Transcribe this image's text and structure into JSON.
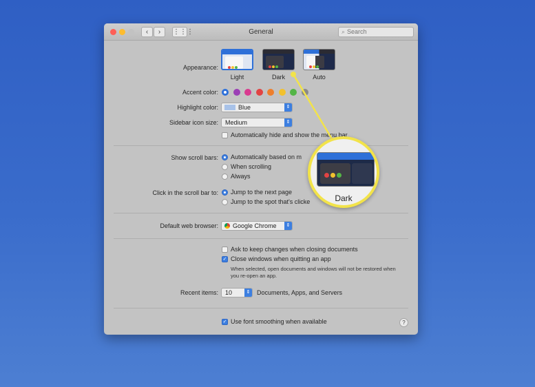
{
  "window": {
    "title": "General",
    "search_placeholder": "Search",
    "nav": {
      "back": "‹",
      "forward": "›",
      "grid": "⋮⋮⋮"
    }
  },
  "appearance": {
    "label": "Appearance:",
    "options": [
      "Light",
      "Dark",
      "Auto"
    ],
    "selected": "Light"
  },
  "accent": {
    "label": "Accent color:",
    "colors": [
      "#2e70d8",
      "#9b3fb5",
      "#d93a8f",
      "#e24343",
      "#ee7f2d",
      "#f2c12e",
      "#54b546",
      "#8a8a8a"
    ]
  },
  "highlight": {
    "label": "Highlight color:",
    "value": "Blue",
    "swatch": "#a8c2e8"
  },
  "sidebar_icon": {
    "label": "Sidebar icon size:",
    "value": "Medium"
  },
  "menu_bar_option": "Automatically hide and show the menu bar",
  "scroll_bars": {
    "label": "Show scroll bars:",
    "options": [
      "Automatically based on m",
      "When scrolling",
      "Always"
    ]
  },
  "click_scroll": {
    "label": "Click in the scroll bar to:",
    "options": [
      "Jump to the next page",
      "Jump to the spot that's clicke"
    ]
  },
  "browser": {
    "label": "Default web browser:",
    "value": "Google Chrome"
  },
  "documents": {
    "ask_keep": "Ask to keep changes when closing documents",
    "close_windows": "Close windows when quitting an app",
    "note": "When selected, open documents and windows will not be restored when you re-open an app."
  },
  "recent": {
    "label": "Recent items:",
    "value": "10",
    "suffix": "Documents, Apps, and Servers"
  },
  "font_smoothing": "Use font smoothing when available",
  "help": "?",
  "callout": {
    "caption": "Dark",
    "color": "#f2e34a"
  }
}
